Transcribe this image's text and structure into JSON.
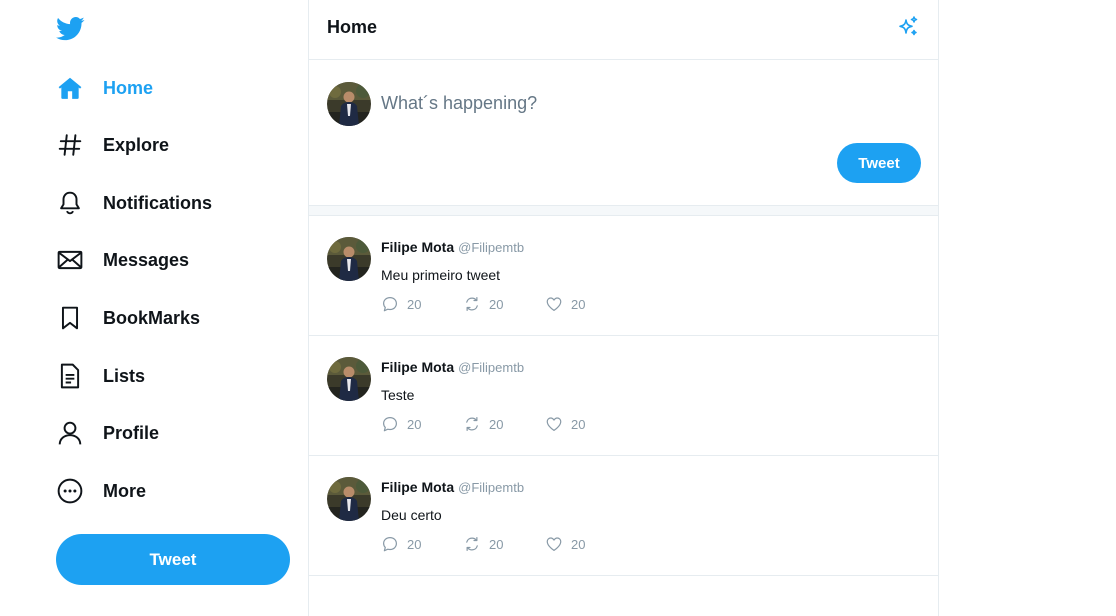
{
  "brand": {
    "logo_icon": "twitter-bird-icon",
    "accent": "#1da1f2"
  },
  "sidebar": {
    "items": [
      {
        "label": "Home",
        "icon": "home-icon",
        "active": true
      },
      {
        "label": "Explore",
        "icon": "hashtag-icon"
      },
      {
        "label": "Notifications",
        "icon": "bell-icon"
      },
      {
        "label": "Messages",
        "icon": "envelope-icon"
      },
      {
        "label": "BookMarks",
        "icon": "bookmark-icon"
      },
      {
        "label": "Lists",
        "icon": "list-icon"
      },
      {
        "label": "Profile",
        "icon": "user-icon"
      },
      {
        "label": "More",
        "icon": "more-icon"
      }
    ],
    "tweet_label": "Tweet"
  },
  "header": {
    "title": "Home",
    "icon": "sparkle-icon"
  },
  "composer": {
    "placeholder": "What´s happening?",
    "button_label": "Tweet"
  },
  "tweets": [
    {
      "name": "Filipe Mota",
      "handle": "@Filipemtb",
      "text": "Meu primeiro tweet",
      "replies": "20",
      "retweets": "20",
      "likes": "20"
    },
    {
      "name": "Filipe Mota",
      "handle": "@Filipemtb",
      "text": "Teste",
      "replies": "20",
      "retweets": "20",
      "likes": "20"
    },
    {
      "name": "Filipe Mota",
      "handle": "@Filipemtb",
      "text": "Deu certo",
      "replies": "20",
      "retweets": "20",
      "likes": "20"
    }
  ]
}
